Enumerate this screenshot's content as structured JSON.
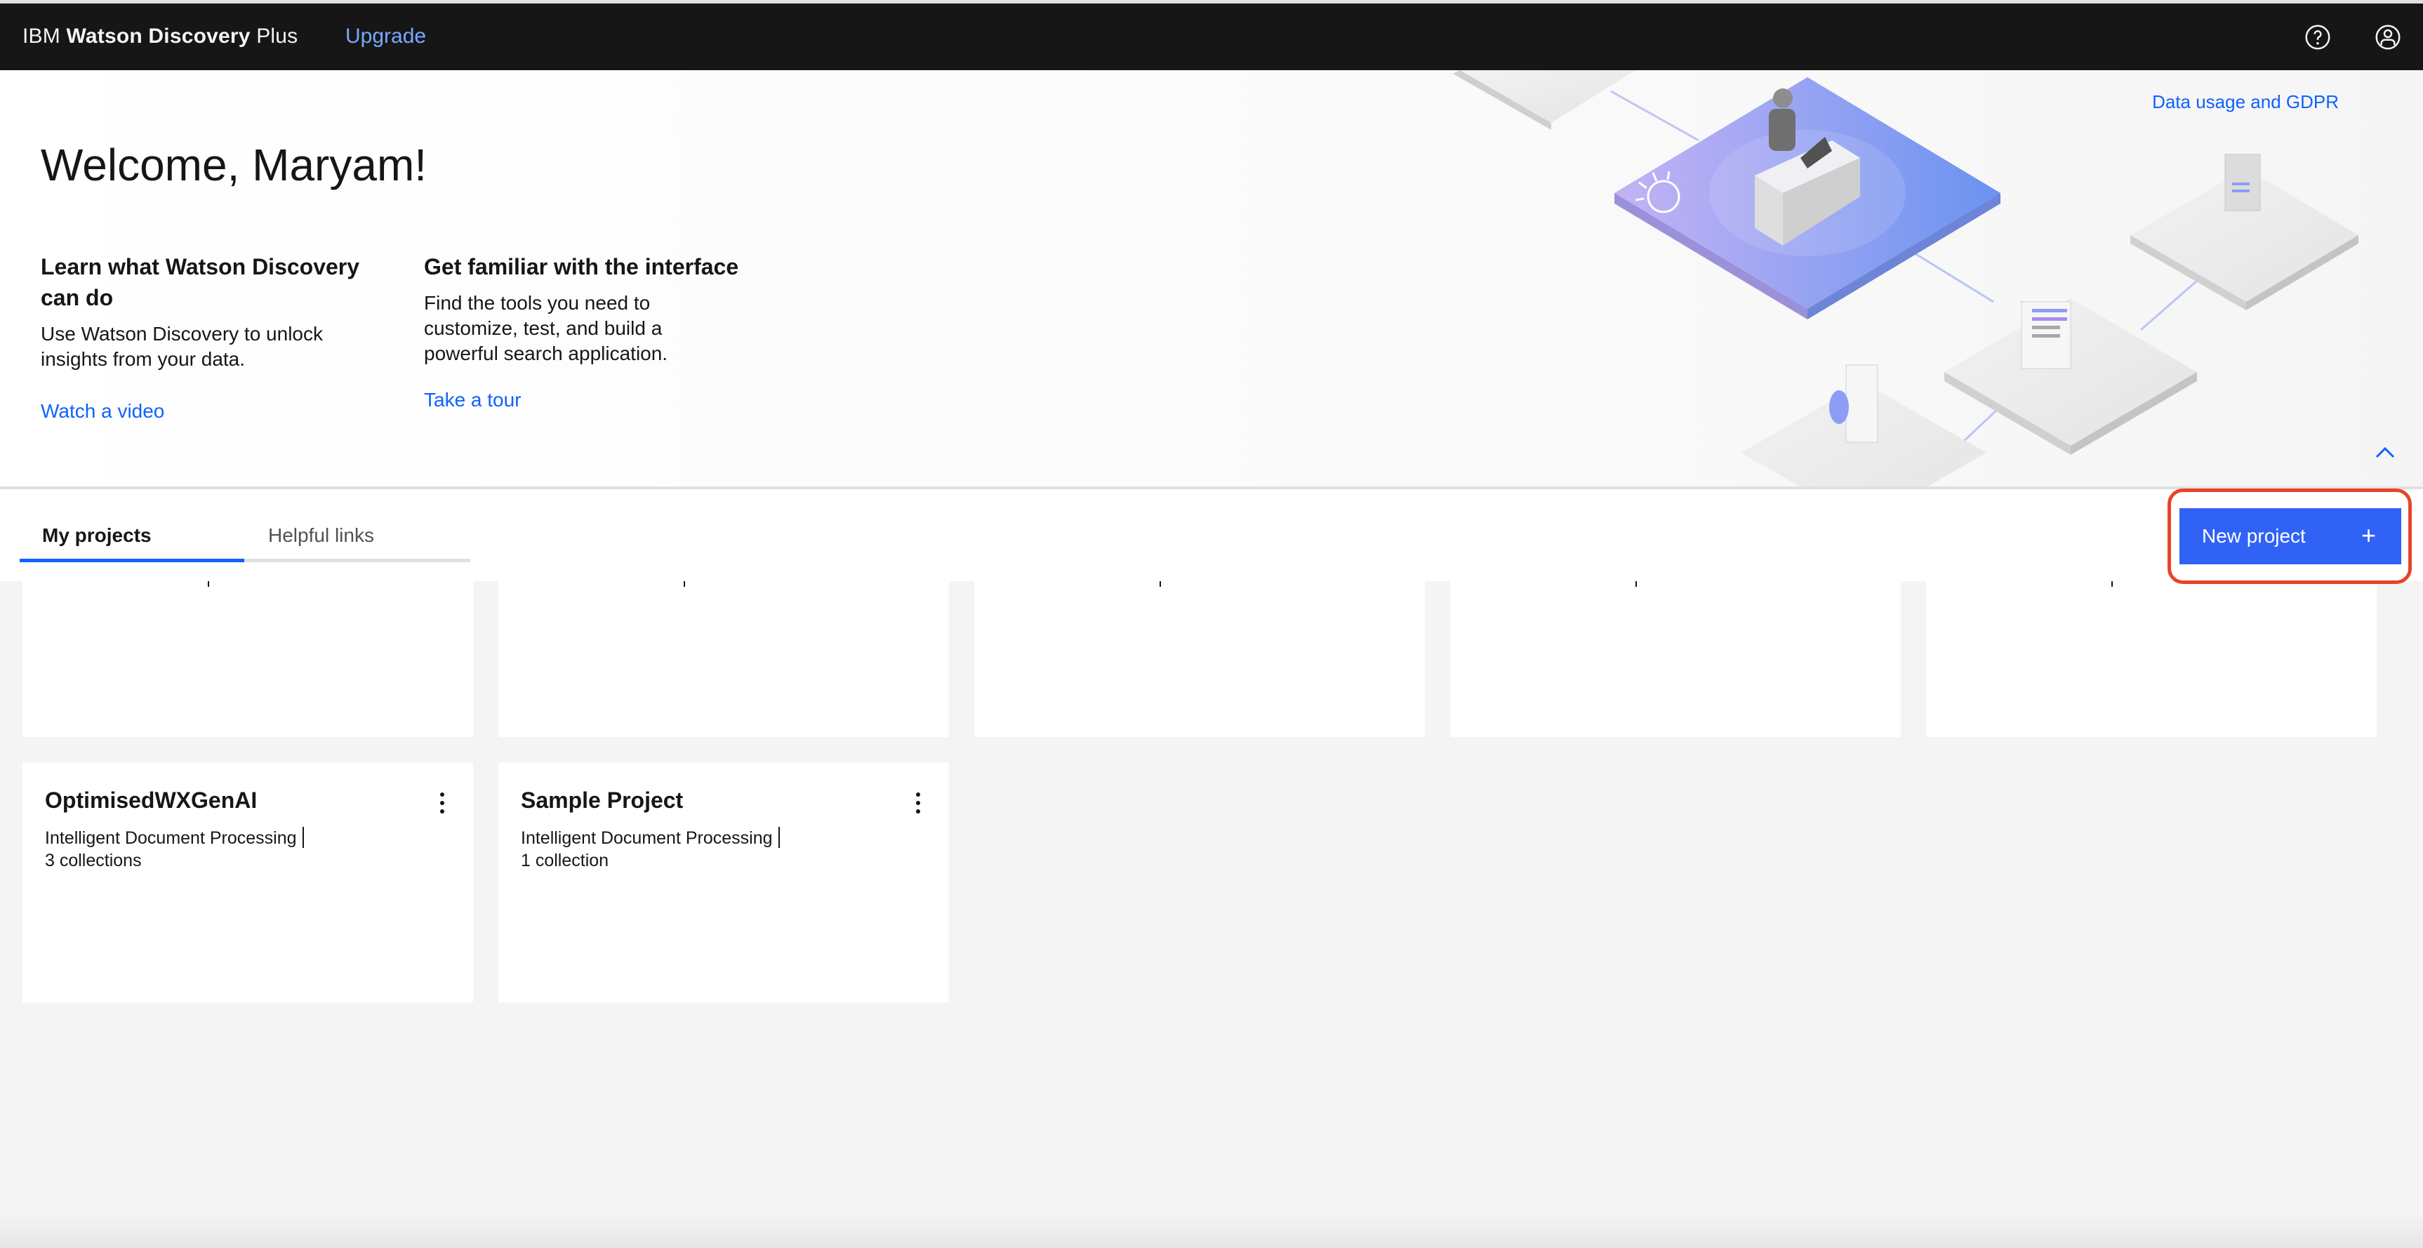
{
  "header": {
    "brand_prefix": "IBM",
    "brand_name": "Watson Discovery",
    "brand_suffix": "Plus",
    "upgrade_label": "Upgrade",
    "help_icon": "help-icon",
    "user_icon": "user-avatar-icon"
  },
  "hero": {
    "welcome": "Welcome, Maryam!",
    "gdpr_link": "Data usage and GDPR",
    "collapse_icon": "chevron-up-icon",
    "columns": [
      {
        "heading": "Learn what Watson Discovery can do",
        "body": "Use Watson Discovery to unlock insights from your data.",
        "link": "Watch a video"
      },
      {
        "heading": "Get familiar with the interface",
        "body": "Find the tools you need to customize, test, and build a powerful search application.",
        "link": "Take a tour"
      }
    ]
  },
  "tabs": [
    {
      "label": "My projects",
      "active": true
    },
    {
      "label": "Helpful links",
      "active": false
    }
  ],
  "new_project": {
    "label": "New project",
    "icon": "+"
  },
  "projects": [
    {
      "name": "OptimisedWXGenAI",
      "type": "Intelligent Document Processing",
      "collections": "3 collections"
    },
    {
      "name": "Sample Project",
      "type": "Intelligent Document Processing",
      "collections": "1 collection"
    }
  ],
  "colors": {
    "topbar": "#161616",
    "link": "#0f62fe",
    "upgrade": "#78a9ff",
    "primary_button": "#3062f6",
    "highlight": "#e8432a",
    "background": "#f4f4f4"
  }
}
